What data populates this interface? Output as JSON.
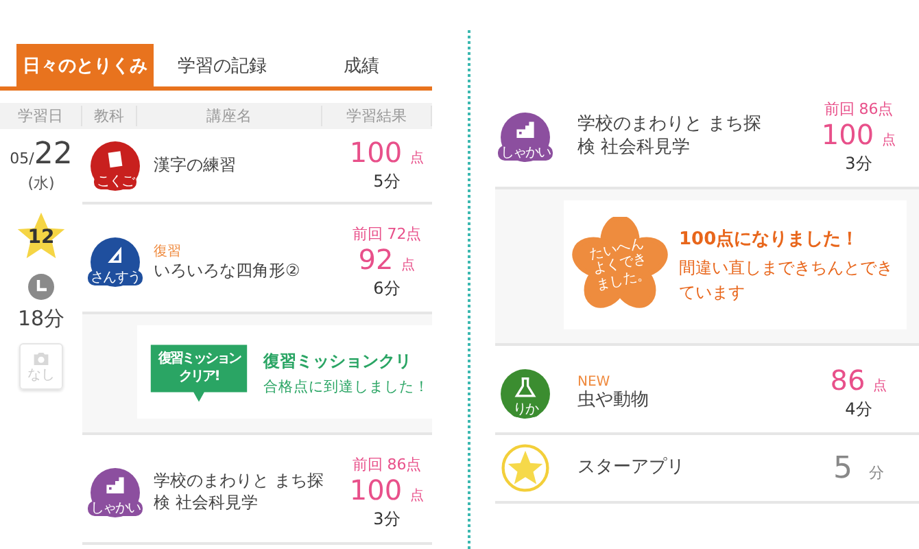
{
  "left_panel": {
    "tabs": [
      {
        "label": "日々のとりくみ",
        "selected": true
      },
      {
        "label": "学習の記録",
        "selected": false
      },
      {
        "label": "成績",
        "selected": false
      }
    ],
    "columns": [
      "学習日",
      "教科",
      "講座名",
      "学習結果"
    ],
    "day": {
      "month": "05/",
      "day": "22",
      "weekday": "(水)",
      "stars": "12",
      "total_time": "18分",
      "photo": "なし"
    },
    "rows": [
      {
        "kind": "lesson",
        "subject": {
          "kind": "kokugo",
          "label": "こくご",
          "color": "#c8201e"
        },
        "title": [
          "漢字の練習"
        ],
        "score": "100",
        "unit": "点",
        "time": "5分"
      },
      {
        "kind": "lesson",
        "subject": {
          "kind": "sansu",
          "label": "さんすう",
          "color": "#1f4f9e"
        },
        "tag": "復習",
        "title": [
          "いろいろな四角形②"
        ],
        "previous": "前回 72点",
        "score": "92",
        "unit": "点",
        "time": "6分"
      },
      {
        "kind": "mission",
        "badge": [
          "復習ミッション",
          "クリア!"
        ],
        "title": "復習ミッションクリ",
        "message": "合格点に到達しました！"
      },
      {
        "kind": "lesson",
        "subject": {
          "kind": "shakai",
          "label": "しゃかい",
          "color": "#8c4f9f"
        },
        "title": [
          "学校のまわりと まち探",
          "検 社会科見学"
        ],
        "previous": "前回 86点",
        "score": "100",
        "unit": "点",
        "time": "3分"
      }
    ]
  },
  "right_panel": {
    "rows": [
      {
        "kind": "lesson",
        "subject": {
          "kind": "shakai",
          "label": "しゃかい",
          "color": "#8c4f9f"
        },
        "title": [
          "学校のまわりと まち探",
          "検 社会科見学"
        ],
        "previous": "前回 86点",
        "score": "100",
        "unit": "点",
        "time": "3分"
      },
      {
        "kind": "perfect",
        "badge": [
          "たいへん",
          "よくでき",
          "ました。"
        ],
        "title": "100点になりました！",
        "message": "間違い直しまできちんとできています"
      },
      {
        "kind": "lesson",
        "subject": {
          "kind": "rika",
          "label": "りか",
          "color": "#3b8d30"
        },
        "tag": "NEW",
        "title": [
          "虫や動物"
        ],
        "score": "86",
        "unit": "点",
        "time": "4分"
      },
      {
        "kind": "app",
        "title": "スターアプリ",
        "time_value": "5",
        "time_unit": "分"
      }
    ]
  }
}
